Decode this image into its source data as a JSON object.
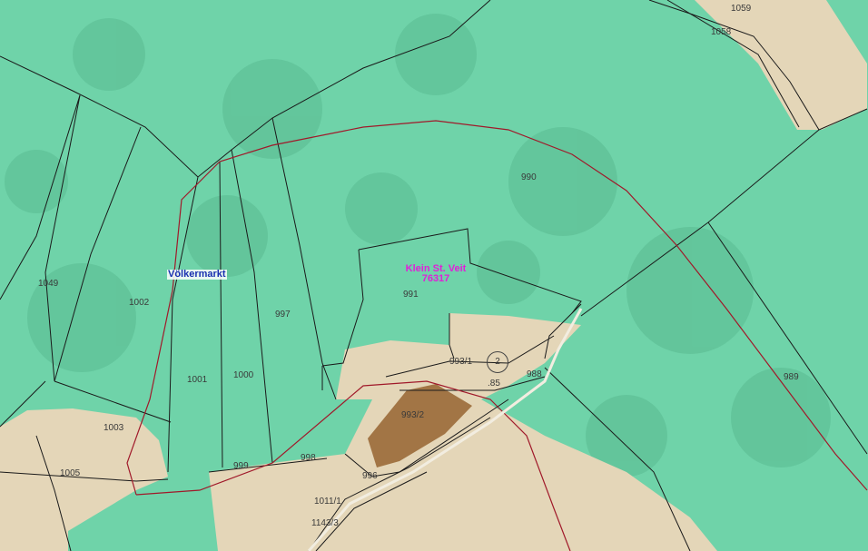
{
  "map": {
    "region_name": "Völkermarkt",
    "locality_name": "Klein St. Veit",
    "locality_code": "76317",
    "marker_number": "2",
    "colors": {
      "forest": "#6fd3a9",
      "open_land": "#e4d6b8",
      "building": "#9a6a38",
      "parcel_line": "#1a1a1a",
      "municipal_border": "#a0192a"
    },
    "parcels": {
      "p1059": "1059",
      "p1058": "1058",
      "p990": "990",
      "p1049": "1049",
      "p1002": "1002",
      "p997": "997",
      "p991": "991",
      "p993_1": "993/1",
      "p988": "988",
      "p85": ".85",
      "p989": "989",
      "p1001": "1001",
      "p1000": "1000",
      "p993_2": "993/2",
      "p1003": "1003",
      "p998": "998",
      "p999": "999",
      "p1005": "1005",
      "p996": "996",
      "p1011_1": "1011/1",
      "p1143_3": "1143/3"
    }
  }
}
